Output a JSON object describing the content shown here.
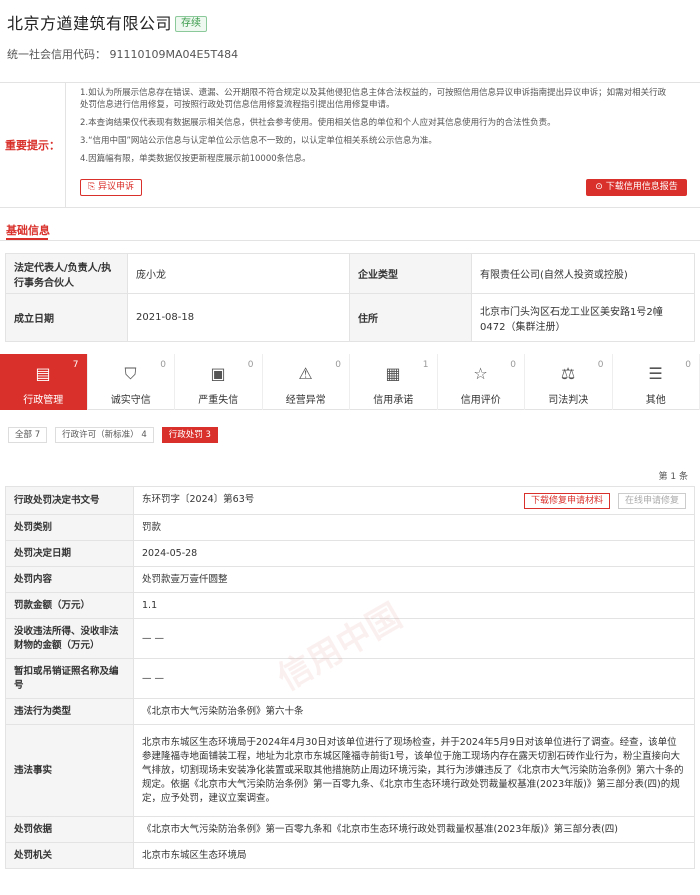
{
  "company": {
    "name": "北京方遒建筑有限公司",
    "status": "存续",
    "credit_code": "统一社会信用代码： 91110109MA04E5T484"
  },
  "notice": {
    "title": "重要提示：",
    "l1a": "1.如认为所展示信息存在错误、遗漏、公开期限不符合规定以及其他侵犯信息主体合法权益的，可按照信用信息异议申诉指南提出异议申诉；如需对相关行政",
    "l1b": "处罚信息进行信用修复，可按照行政处罚信息信用修复流程指引提出信用修复申请。",
    "l2": "2.本查询结果仅代表现有数据展示相关信息，供社会参考使用。使用相关信息的单位和个人应对其信息使用行为的合法性负责。",
    "l3": "3.“信用中国”网站公示信息与认定单位公示信息不一致的，以认定单位相关系统公示信息为准。",
    "l4": "4.因篇幅有限，单类数据仅按更新程度展示前10000条信息。",
    "appeal": "异议申诉",
    "download": "下载信用信息报告"
  },
  "basic": {
    "title": "基础信息",
    "rows": [
      [
        "法定代表人/负责人/执行事务合伙人",
        "庞小龙",
        "企业类型",
        "有限责任公司(自然人投资或控股)"
      ],
      [
        "成立日期",
        "2021-08-18",
        "住所",
        "北京市门头沟区石龙工业区美安路1号2幢0472（集群注册）"
      ]
    ]
  },
  "tabs": [
    {
      "label": "行政管理",
      "count": "7",
      "icon": "doc-icon",
      "on": true
    },
    {
      "label": "诚实守信",
      "count": "0",
      "icon": "shield-icon"
    },
    {
      "label": "严重失信",
      "count": "0",
      "icon": "bus-icon"
    },
    {
      "label": "经营异常",
      "count": "0",
      "icon": "alarm-icon"
    },
    {
      "label": "信用承诺",
      "count": "1",
      "icon": "book-icon"
    },
    {
      "label": "信用评价",
      "count": "0",
      "icon": "star-icon"
    },
    {
      "label": "司法判决",
      "count": "0",
      "icon": "scale-icon"
    },
    {
      "label": "其他",
      "count": "0",
      "icon": "list-icon"
    }
  ],
  "filters": [
    {
      "label": "全部  7"
    },
    {
      "label": "行政许可（新标准）  4"
    },
    {
      "label": "行政处罚  3",
      "on": true
    }
  ],
  "page_info": "第 1 条",
  "detail": {
    "btn_download": "下载修复申请材料",
    "btn_online": "在线申请修复",
    "rows": [
      [
        "行政处罚决定书文号",
        "东环罚字〔2024〕第63号"
      ],
      [
        "处罚类别",
        "罚款"
      ],
      [
        "处罚决定日期",
        "2024-05-28"
      ],
      [
        "处罚内容",
        "处罚款壹万壹仟圆整"
      ],
      [
        "罚款金额（万元）",
        "1.1"
      ],
      [
        "没收违法所得、没收非法财物的金额（万元）",
        "— —"
      ],
      [
        "暂扣或吊销证照名称及编号",
        "— —"
      ],
      [
        "违法行为类型",
        "《北京市大气污染防治条例》第六十条"
      ],
      [
        "违法事实",
        "北京市东城区生态环境局于2024年4月30日对该单位进行了现场检查，并于2024年5月9日对该单位进行了调查。经查，该单位参建隆福寺地面铺装工程，地址为北京市东城区隆福寺前街1号，该单位于施工现场内存在露天切割石砖作业行为，粉尘直接向大气排放，切割现场未安装净化装置或采取其他措施防止周边环境污染，其行为涉嫌违反了《北京市大气污染防治条例》第六十条的规定。依据《北京市大气污染防治条例》第一百零九条、《北京市生态环境行政处罚裁量权基准(2023年版)》第三部分表(四)的规定，应予处罚，建议立案调查。"
      ],
      [
        "处罚依据",
        "《北京市大气污染防治条例》第一百零九条和《北京市生态环境行政处罚裁量权基准(2023年版)》第三部分表(四)"
      ],
      [
        "处罚机关",
        "北京市东城区生态环境局"
      ]
    ]
  },
  "watermark": "信用中国"
}
